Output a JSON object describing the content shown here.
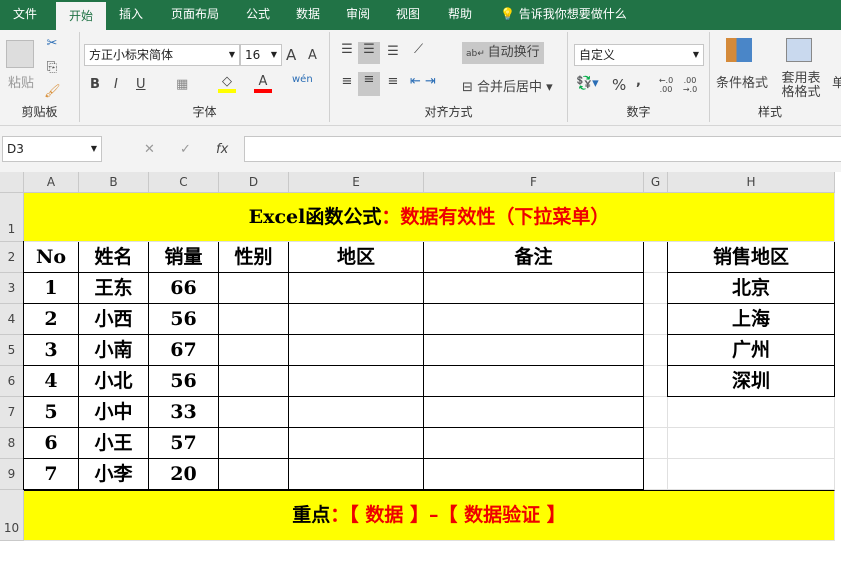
{
  "tabs": [
    "文件",
    "开始",
    "插入",
    "页面布局",
    "公式",
    "数据",
    "审阅",
    "视图",
    "帮助"
  ],
  "tell_me": "告诉我你想要做什么",
  "ribbon": {
    "clipboard": {
      "paste": "粘贴",
      "label": "剪贴板"
    },
    "font": {
      "name": "方正小标宋简体",
      "size": "16",
      "bold": "B",
      "italic": "I",
      "underline": "U",
      "grow": "A",
      "shrink": "A",
      "color_letter": "A",
      "phonetic": "wén",
      "label": "字体",
      "fill_color": "#ffff00",
      "font_color": "#ff0000"
    },
    "align": {
      "wrap": "自动换行",
      "merge": "合并后居中",
      "label": "对齐方式"
    },
    "number": {
      "format": "自定义",
      "percent": "%",
      "comma": ",",
      "inc": "←.0 .00",
      "dec": ".00 →.0",
      "label": "数字"
    },
    "styles": {
      "conditional": "条件格式",
      "table": "套用表格格式",
      "cell": "单",
      "label": "样式"
    }
  },
  "formula_bar": {
    "name_box": "D3",
    "fx": "fx",
    "cancel": "✕",
    "enter": "✓",
    "value": ""
  },
  "columns": [
    "A",
    "B",
    "C",
    "D",
    "E",
    "F",
    "G",
    "H"
  ],
  "rows": [
    "1",
    "2",
    "3",
    "4",
    "5",
    "6",
    "7",
    "8",
    "9",
    "10"
  ],
  "sheet": {
    "title_black": "Excel函数公式",
    "title_red": "：数据有效性（下拉菜单）",
    "headers": [
      "No",
      "姓名",
      "销量",
      "性别",
      "地区",
      "备注"
    ],
    "data": [
      [
        "1",
        "王东",
        "66"
      ],
      [
        "2",
        "小西",
        "56"
      ],
      [
        "3",
        "小南",
        "67"
      ],
      [
        "4",
        "小北",
        "56"
      ],
      [
        "5",
        "小中",
        "33"
      ],
      [
        "6",
        "小王",
        "57"
      ],
      [
        "7",
        "小李",
        "20"
      ]
    ],
    "region_header": "销售地区",
    "regions": [
      "北京",
      "上海",
      "广州",
      "深圳"
    ],
    "footer_black": "重点",
    "footer_red": "：【 数据 】–【 数据验证 】"
  }
}
